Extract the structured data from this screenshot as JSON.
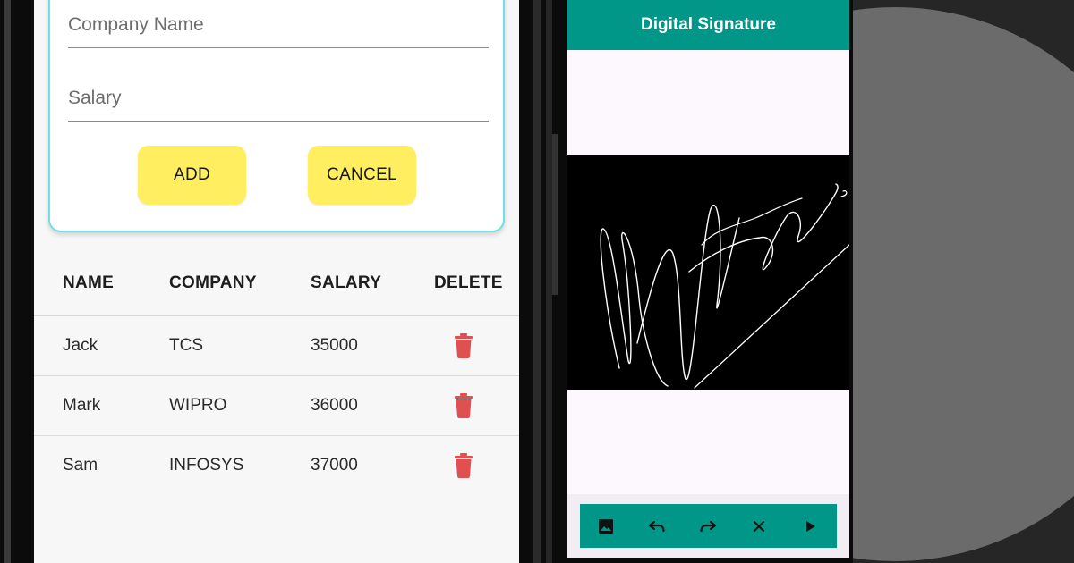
{
  "left_app": {
    "form": {
      "company_placeholder": "Company Name",
      "salary_placeholder": "Salary",
      "add_label": "ADD",
      "cancel_label": "CANCEL"
    },
    "table": {
      "headers": [
        "NAME",
        "COMPANY",
        "SALARY",
        "DELETE"
      ],
      "rows": [
        {
          "name": "Jack",
          "company": "TCS",
          "salary": "35000",
          "delete_icon": "trash-icon"
        },
        {
          "name": "Mark",
          "company": "WIPRO",
          "salary": "36000",
          "delete_icon": "trash-icon"
        },
        {
          "name": "Sam",
          "company": "INFOSYS",
          "salary": "37000",
          "delete_icon": "trash-icon"
        }
      ]
    }
  },
  "right_app": {
    "title": "Digital Signature",
    "toolbar": {
      "icons": [
        "image-icon",
        "undo-icon",
        "redo-icon",
        "close-icon",
        "play-icon"
      ]
    }
  },
  "colors": {
    "accent_teal": "#009688",
    "button_yellow": "#ffee5f",
    "card_border": "#6fe0e6",
    "delete_red": "#e05050"
  }
}
